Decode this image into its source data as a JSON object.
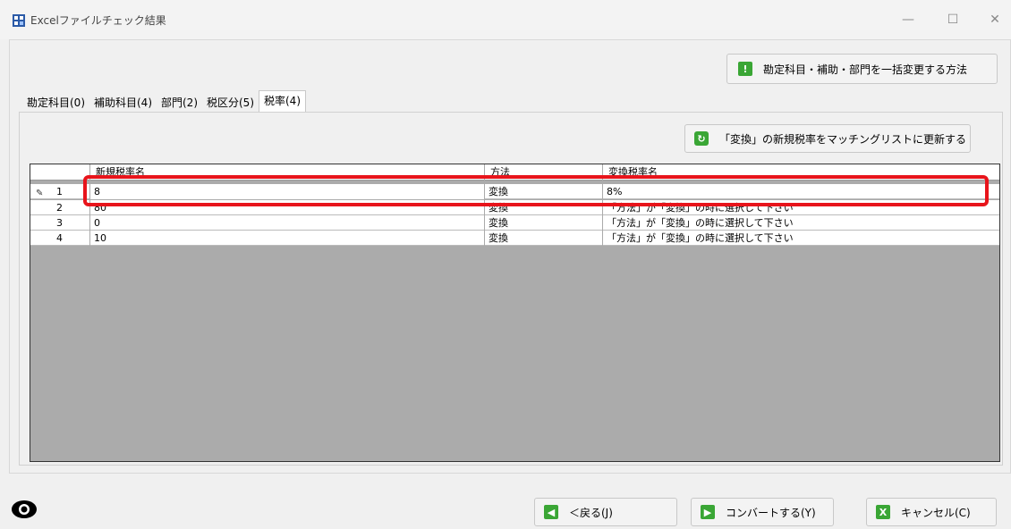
{
  "window": {
    "title": "Excelファイルチェック結果",
    "minimize_glyph": "—",
    "maximize_glyph": "☐",
    "close_glyph": "✕"
  },
  "toolbar": {
    "method_button_label": "勘定科目・補助・部門を一括変更する方法",
    "update_button_label": "「変換」の新規税率をマッチングリストに更新する"
  },
  "tabs": [
    {
      "label": "勘定科目(0)"
    },
    {
      "label": "補助科目(4)"
    },
    {
      "label": "部門(2)"
    },
    {
      "label": "税区分(5)"
    },
    {
      "label": "税率(4)"
    }
  ],
  "grid": {
    "columns": [
      "新規税率名",
      "方法",
      "変換税率名"
    ],
    "rows": [
      {
        "num": "1",
        "name": "8",
        "method": "変換",
        "target": "8%"
      },
      {
        "num": "2",
        "name": "80",
        "method": "変換",
        "target": "「方法」が「変換」の時に選択して下さい"
      },
      {
        "num": "3",
        "name": "0",
        "method": "変換",
        "target": "「方法」が「変換」の時に選択して下さい"
      },
      {
        "num": "4",
        "name": "10",
        "method": "変換",
        "target": "「方法」が「変換」の時に選択して下さい"
      }
    ]
  },
  "footer": {
    "back_label": "＜戻る(J)",
    "convert_label": "コンバートする(Y)",
    "cancel_label": "キャンセル(C)"
  },
  "colors": {
    "accent_green": "#3aa635",
    "highlight_red": "#e8141b",
    "grid_background": "#ababab"
  }
}
